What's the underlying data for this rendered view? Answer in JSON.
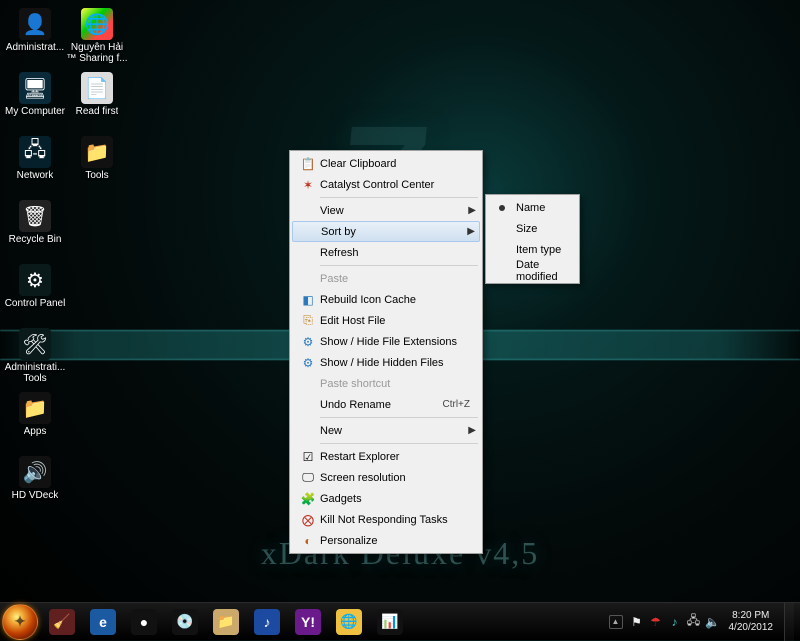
{
  "wallpaper": {
    "title": "xDark Deluxe v4,5",
    "big_glyph": "7"
  },
  "desktop_icons": [
    {
      "name": "administrator",
      "label": "Administrat...",
      "glyph": "👤",
      "bg": "#111"
    },
    {
      "name": "nguyen-hai-sharing",
      "label": "Nguyễn Hải ™ Sharing f...",
      "glyph": "🌐",
      "bg": "linear-gradient(135deg,#ff4,#0c0 40%,#f44 70%)"
    },
    {
      "name": "my-computer",
      "label": "My Computer",
      "glyph": "🖥",
      "bg": "#0a2a3a"
    },
    {
      "name": "read-first",
      "label": "Read first",
      "glyph": "📄",
      "bg": "#ddd"
    },
    {
      "name": "network",
      "label": "Network",
      "glyph": "🖧",
      "bg": "#05202a"
    },
    {
      "name": "tools",
      "label": "Tools",
      "glyph": "📁",
      "bg": "#111"
    },
    {
      "name": "recycle-bin",
      "label": "Recycle Bin",
      "glyph": "🗑",
      "bg": "#222"
    },
    {
      "name": "control-panel",
      "label": "Control Panel",
      "glyph": "⚙",
      "bg": "#0a1a1a"
    },
    {
      "name": "administrative-tools",
      "label": "Administrati... Tools",
      "glyph": "🛠",
      "bg": "#0a1a1a"
    },
    {
      "name": "apps",
      "label": "Apps",
      "glyph": "📁",
      "bg": "#111"
    },
    {
      "name": "hd-vdeck",
      "label": "HD VDeck",
      "glyph": "🔊",
      "bg": "#111"
    }
  ],
  "context_menu": {
    "clear_clipboard": "Clear Clipboard",
    "catalyst": "Catalyst Control Center",
    "view": "View",
    "sort_by": "Sort by",
    "refresh": "Refresh",
    "paste": "Paste",
    "rebuild_icon_cache": "Rebuild Icon Cache",
    "edit_host_file": "Edit Host File",
    "show_hide_ext": "Show / Hide File Extensions",
    "show_hide_hidden": "Show / Hide Hidden Files",
    "paste_shortcut": "Paste shortcut",
    "undo_rename": "Undo Rename",
    "undo_shortcut": "Ctrl+Z",
    "new": "New",
    "restart_explorer": "Restart Explorer",
    "screen_resolution": "Screen resolution",
    "gadgets": "Gadgets",
    "kill_tasks": "Kill Not Responding Tasks",
    "personalize": "Personalize"
  },
  "sort_submenu": {
    "name": "Name",
    "size": "Size",
    "item_type": "Item type",
    "date_modified": "Date modified"
  },
  "taskbar": {
    "pins": [
      {
        "name": "cc-cleaner",
        "glyph": "🧹",
        "bg": "#602020"
      },
      {
        "name": "ie",
        "glyph": "e",
        "bg": "#1b5aa0"
      },
      {
        "name": "media-center",
        "glyph": "●",
        "bg": "#111"
      },
      {
        "name": "disc",
        "glyph": "💿",
        "bg": "#111"
      },
      {
        "name": "explorer",
        "glyph": "📁",
        "bg": "#caa96a"
      },
      {
        "name": "music",
        "glyph": "♪",
        "bg": "#1b4aa0"
      },
      {
        "name": "messenger",
        "glyph": "Y!",
        "bg": "#6a1a8a"
      },
      {
        "name": "chrome",
        "glyph": "🌐",
        "bg": "#f0c040"
      },
      {
        "name": "task-manager",
        "glyph": "📊",
        "bg": "#111"
      }
    ]
  },
  "tray": {
    "icons": [
      {
        "name": "action-center-icon",
        "glyph": "⚑",
        "color": "#eee"
      },
      {
        "name": "security-icon",
        "glyph": "☂",
        "color": "#e03030"
      },
      {
        "name": "audio-mixer-icon",
        "glyph": "♪",
        "color": "#4ac0c0"
      },
      {
        "name": "network-icon",
        "glyph": "🖧",
        "color": "#ddd"
      },
      {
        "name": "volume-icon",
        "glyph": "🔈",
        "color": "#ddd"
      }
    ],
    "time": "8:20 PM",
    "date": "4/20/2012"
  }
}
